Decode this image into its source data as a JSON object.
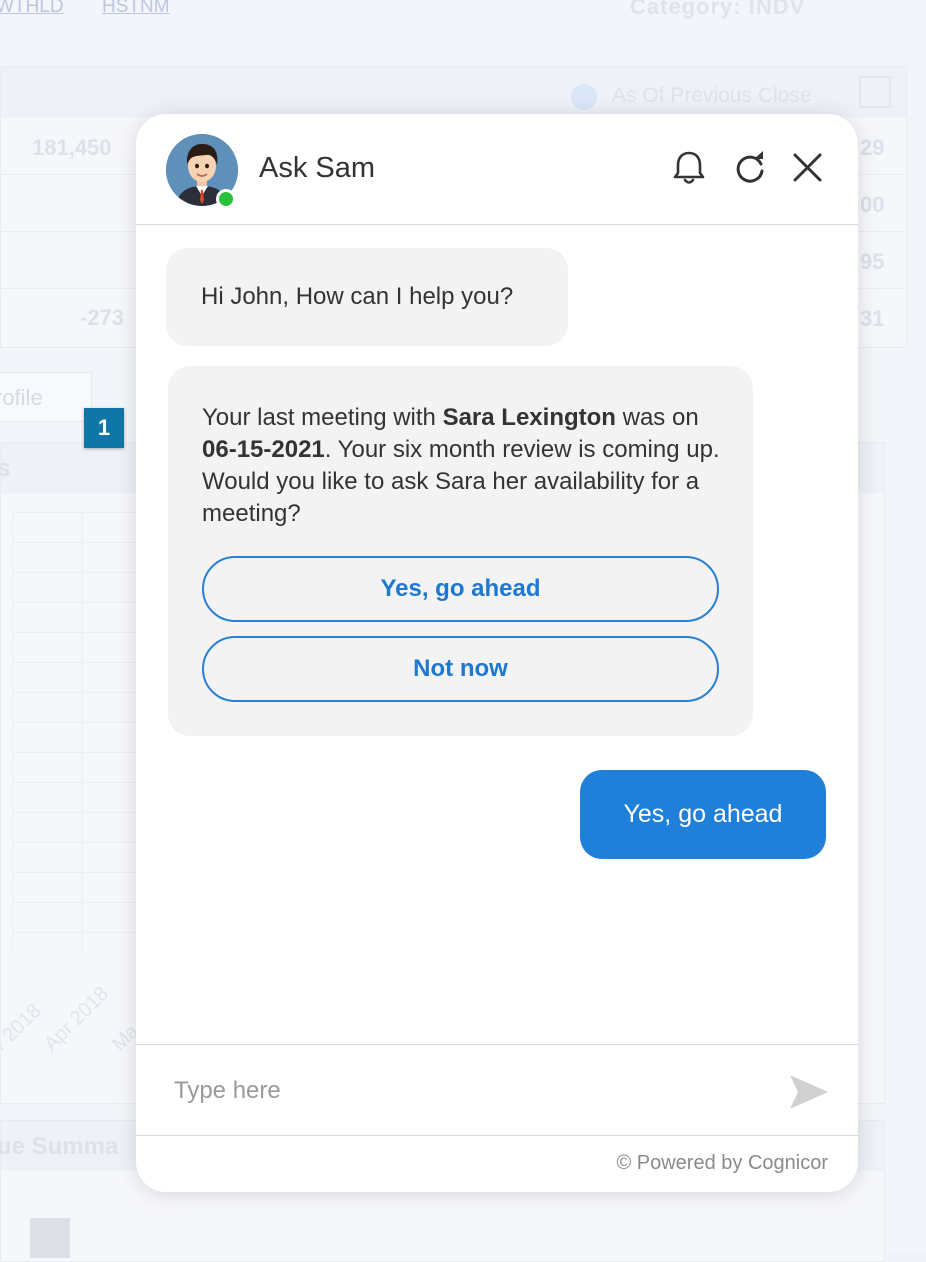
{
  "background": {
    "links": [
      "WTHLD",
      "HSTNM"
    ],
    "category_label": "Category: INDV",
    "radio_label": "As Of Previous Close",
    "left_values": [
      "181,450",
      "-273"
    ],
    "right_values": [
      "29",
      "00",
      "95",
      "31"
    ],
    "profile_label": "rofile",
    "chart_header": "s",
    "x_axis_labels": [
      "r 2018",
      "Apr 2018",
      "Ma"
    ],
    "summary_header": "ue Summa"
  },
  "marker": {
    "label": "1"
  },
  "chat": {
    "title": "Ask Sam",
    "greeting": "Hi John, How can I help you?",
    "message": {
      "part1": "Your last meeting with ",
      "name": "Sara Lexington",
      "part2": " was on ",
      "date": "06-15-2021",
      "part3": ". Your six month review is coming up. Would you like to ask Sara her availability for a meeting?"
    },
    "options": [
      "Yes, go ahead",
      "Not now"
    ],
    "user_reply": "Yes, go ahead",
    "input_placeholder": "Type here",
    "footer": "© Powered by Cognicor",
    "colors": {
      "accent": "#1f7fd9",
      "online": "#27c23a",
      "marker": "#0e77a8"
    },
    "icons": [
      "bell-icon",
      "refresh-icon",
      "close-icon",
      "send-icon"
    ]
  }
}
